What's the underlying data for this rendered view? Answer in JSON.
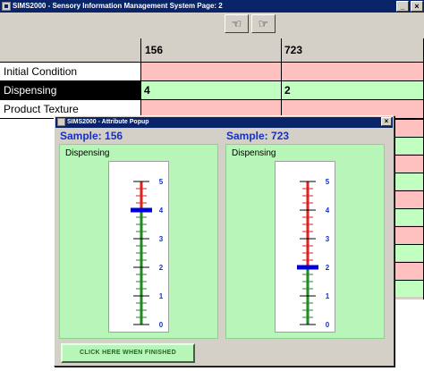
{
  "window": {
    "title": "SIMS2000 - Sensory Information Management System   Page: 2"
  },
  "nav": {
    "prev_glyph": "☜",
    "next_glyph": "☞"
  },
  "grid": {
    "columns": [
      "156",
      "723"
    ],
    "rows": [
      {
        "label": "Initial Condition",
        "values": [
          "",
          ""
        ],
        "colors": [
          "#ffc0c0",
          "#ffc0c0"
        ]
      },
      {
        "label": "Dispensing",
        "values": [
          "4",
          "2"
        ],
        "colors": [
          "#c0ffc0",
          "#c0ffc0"
        ],
        "selected": true
      },
      {
        "label": "Product Texture",
        "values": [
          "",
          ""
        ],
        "colors": [
          "#ffc0c0",
          "#ffc0c0"
        ]
      }
    ]
  },
  "popup": {
    "title": "SIMS2000 - Attribute Popup",
    "close_glyph": "×",
    "finish_label": "CLICK  HERE  WHEN  FINISHED",
    "samples": [
      {
        "title": "Sample: 156",
        "attribute": "Dispensing",
        "value": 4,
        "scale": [
          "0",
          "1",
          "2",
          "3",
          "4",
          "5"
        ]
      },
      {
        "title": "Sample: 723",
        "attribute": "Dispensing",
        "value": 2,
        "scale": [
          "0",
          "1",
          "2",
          "3",
          "4",
          "5"
        ]
      }
    ]
  },
  "colors": {
    "titlebar": "#0a246a",
    "pink": "#ffc0c0",
    "green": "#c0ffc0",
    "panel": "#b8f5b8",
    "accent": "#1530c8",
    "scale_red": "#dd2222",
    "scale_green": "#228822",
    "marker": "#0000dd"
  }
}
